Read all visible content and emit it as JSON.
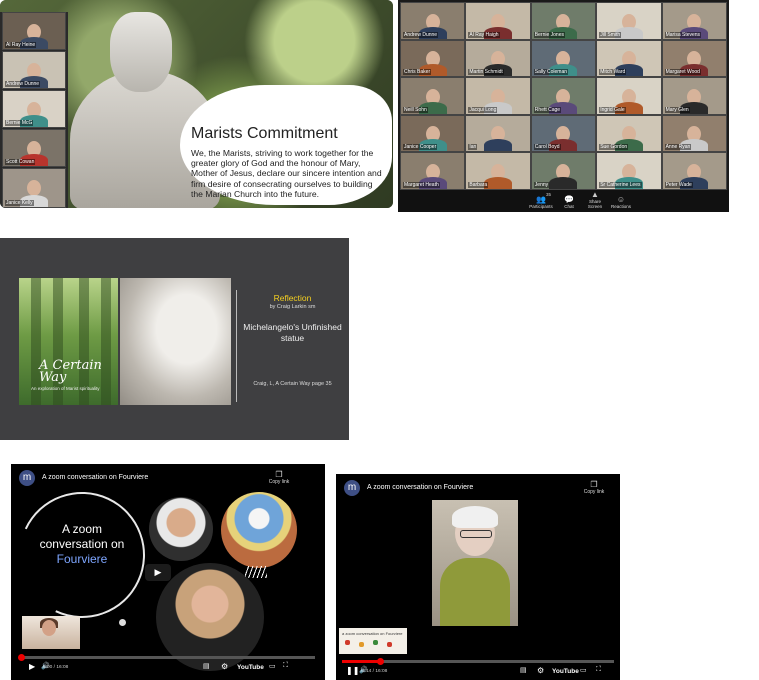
{
  "panel1": {
    "title": "Marists Commitment",
    "body": "We, the Marists, striving to work together for the greater glory of God and the honour of Mary, Mother of Jesus, declare our sincere intention and firm desire of consecrating ourselves to building the Marian Church into the future.",
    "participants": [
      "Al Ray Heine",
      "Andrew Dunne",
      "Bernie McG",
      "Scott Cowan",
      "Janice Kelly"
    ]
  },
  "panel2": {
    "participants": [
      "Andrew Dunne",
      "Al Ray Haigh",
      "Bernie Jones",
      "Jill Smith",
      "Marisa Stevens",
      "Chris Baker",
      "Martin Schmidt",
      "Sally Coleman",
      "Mitch Ward",
      "Margaret Wood",
      "Neill Sohn",
      "Jacqui Long",
      "Rhett Cage",
      "Ingrid Gale",
      "Mary Glen",
      "Janice Cooper",
      "Ian",
      "Carol Boyd",
      "Sue Gordon",
      "Anne Ryan",
      "Margaret Heath",
      "Barbara",
      "Jenny",
      "Sr Catherine Lees",
      "Peter Wade"
    ],
    "toolbar": {
      "participants_label": "Participants",
      "participants_count": "35",
      "chat_label": "Chat",
      "share_label": "Share Screen",
      "reactions_label": "Reactions"
    }
  },
  "panel3": {
    "reflection_title": "Reflection",
    "byline": "by Craig Larkin sm",
    "subject": "Michelangelo's Unfinished statue",
    "citation": "Craig, L, A Certain Way page 35",
    "book_title": "A Certain Way",
    "book_subtitle": "An exploration of Marist spirituality"
  },
  "panel4": {
    "channel_initial": "m",
    "video_title": "A zoom conversation on Fourviere",
    "copy_label": "Copy link",
    "slide_line1": "A zoom",
    "slide_line2": "conversation on",
    "slide_line3": "Fourviere",
    "time": "0:00 / 16:08",
    "youtube_label": "YouTube",
    "progress": 0.0
  },
  "panel5": {
    "channel_initial": "m",
    "video_title": "A zoom conversation on Fourviere",
    "copy_label": "Copy link",
    "time": "7:14 / 16:08",
    "youtube_label": "YouTube",
    "progress": 0.14,
    "mini_caption": "a zoom conversation on Fourviere"
  },
  "colors": {
    "accent_yellow": "#f5d020",
    "youtube_red": "#e00000",
    "fourviere_blue": "#7ea6ff",
    "share_green": "#2db85a"
  }
}
